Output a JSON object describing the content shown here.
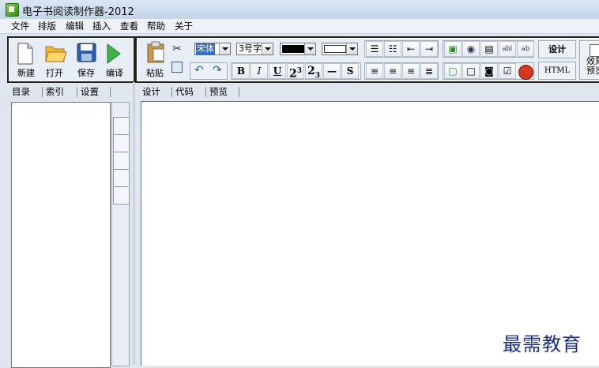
{
  "window": {
    "title": "电子书阅读制作器-2012"
  },
  "menu": [
    "文件",
    "排版",
    "编辑",
    "插入",
    "查看",
    "帮助",
    "关于"
  ],
  "main_toolbar": {
    "new": "新建",
    "open": "打开",
    "save": "保存",
    "compile": "编译"
  },
  "edit_toolbar": {
    "paste": "粘贴",
    "font_name": "宋体",
    "font_size": "3号字",
    "font_color": "#000000",
    "bg_color": "#ffffff",
    "bold": "B",
    "italic": "I",
    "underline": "U",
    "superscript": "2",
    "superscript_exp": "3",
    "subscript": "2",
    "subscript_idx": "3",
    "hr": "—",
    "strike": "S",
    "design": "设计",
    "html": "HTML",
    "preview_effect": "效果预览"
  },
  "left_tabs": [
    "目录",
    "索引",
    "设置"
  ],
  "editor_tabs": [
    "设计",
    "代码",
    "预览"
  ],
  "watermark": "最需教育"
}
